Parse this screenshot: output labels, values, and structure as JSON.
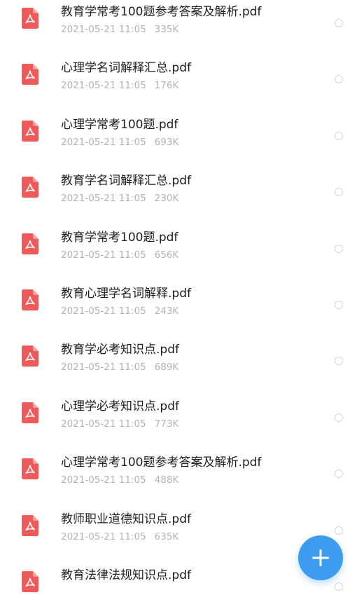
{
  "files": [
    {
      "name": "教育学常考100题参考答案及解析.pdf",
      "date": "2021-05-21 11:05",
      "size": "335K"
    },
    {
      "name": "心理学名词解释汇总.pdf",
      "date": "2021-05-21 11:05",
      "size": "176K"
    },
    {
      "name": "心理学常考100题.pdf",
      "date": "2021-05-21 11:05",
      "size": "693K"
    },
    {
      "name": "教育学名词解释汇总.pdf",
      "date": "2021-05-21 11:05",
      "size": "230K"
    },
    {
      "name": "教育学常考100题.pdf",
      "date": "2021-05-21 11:05",
      "size": "656K"
    },
    {
      "name": "教育心理学名词解释.pdf",
      "date": "2021-05-21 11:05",
      "size": "243K"
    },
    {
      "name": "教育学必考知识点.pdf",
      "date": "2021-05-21 11:05",
      "size": "689K"
    },
    {
      "name": "心理学必考知识点.pdf",
      "date": "2021-05-21 11:05",
      "size": "773K"
    },
    {
      "name": "心理学常考100题参考答案及解析.pdf",
      "date": "2021-05-21 11:05",
      "size": "488K"
    },
    {
      "name": "教师职业道德知识点.pdf",
      "date": "2021-05-21 11:05",
      "size": "635K"
    },
    {
      "name": "教育法律法规知识点.pdf",
      "date": "",
      "size": ""
    }
  ],
  "icons": {
    "file_icon": "pdf-file-icon",
    "file_icon_color": "#ee5a5a",
    "fab_icon": "plus-icon",
    "fab_color": "#3e9cf0"
  }
}
